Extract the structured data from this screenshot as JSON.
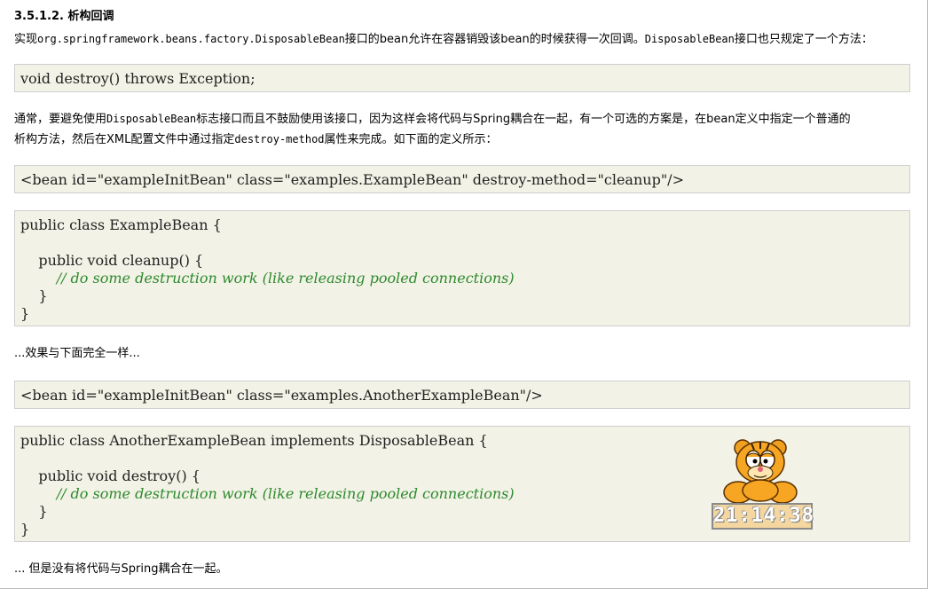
{
  "section": {
    "number": "3.5.1.2.",
    "title": "析构回调"
  },
  "intro": {
    "part1": "实现",
    "code1": "org.springframework.beans.factory.DisposableBean",
    "part2": "接口的bean允许在容器销毁该bean的时候获得一次回调。",
    "code2": "DisposableBean",
    "part3": "接口也只规定了一个方法："
  },
  "code_destroy": "void destroy() throws Exception;",
  "para2": {
    "part1": "通常，要避免使用",
    "code1": "DisposableBean",
    "part2": "标志接口而且不鼓励使用该接口，因为这样会将代码与Spring耦合在一起，有一个可选的方案是，在bean定义中指定一个普通的",
    "part3": "析构方法，然后在XML配置文件中通过指定",
    "code2": "destroy-method",
    "part4": "属性来完成。如下面的定义所示："
  },
  "code_bean1": "<bean id=\"exampleInitBean\" class=\"examples.ExampleBean\" destroy-method=\"cleanup\"/>",
  "code_class1": {
    "line1": "public class ExampleBean {",
    "line2": "    public void cleanup() {",
    "comment": "        // do some destruction work (like releasing pooled connections)",
    "line3": "    }",
    "line4": "}"
  },
  "para3": "...效果与下面完全一样...",
  "code_bean2": "<bean id=\"exampleInitBean\" class=\"examples.AnotherExampleBean\"/>",
  "code_class2": {
    "line1": "public class AnotherExampleBean implements DisposableBean {",
    "line2": "    public void destroy() {",
    "comment": "        // do some destruction work (like releasing pooled connections)",
    "line3": "    }",
    "line4": "}"
  },
  "para4": "... 但是没有将代码与Spring耦合在一起。",
  "clock": {
    "time": "21:14:38",
    "mascot": "cat-mascot-icon"
  },
  "colors": {
    "code_background": "#f2f2e6",
    "comment": "#2e8a2e"
  }
}
